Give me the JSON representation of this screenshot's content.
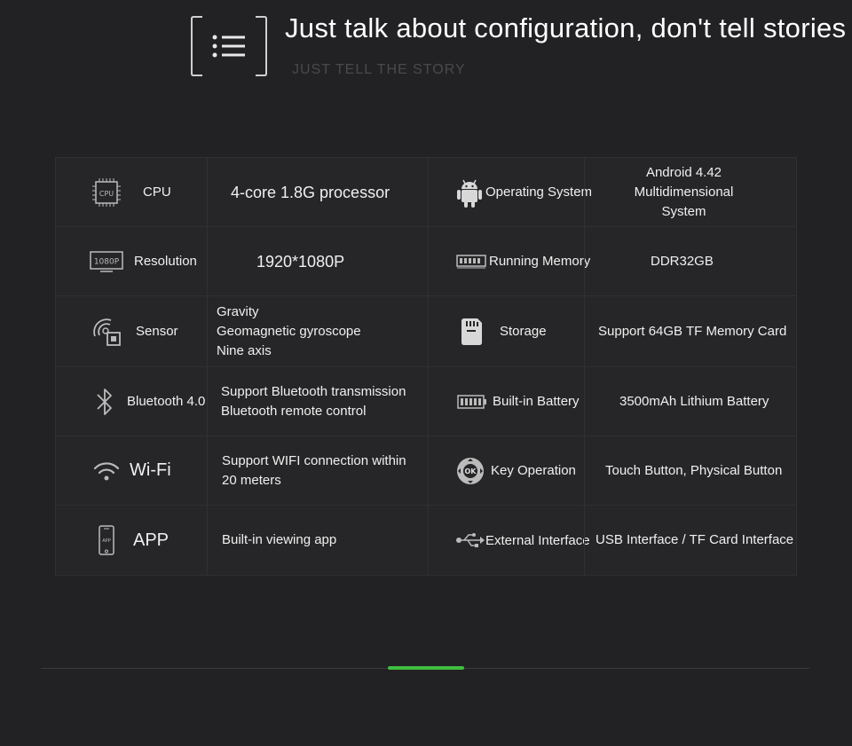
{
  "header": {
    "title": "Just talk about configuration, don't tell stories",
    "subtitle": "JUST TELL THE STORY",
    "icon": "list-menu-icon"
  },
  "specs": [
    {
      "left_label": "CPU",
      "left_icon": "cpu-chip-icon",
      "left_icon_text": "CPU",
      "left_value": "4-core 1.8G processor",
      "right_label": "Operating System",
      "right_icon": "android-icon",
      "right_value": "Android 4.42\nMultidimensional System"
    },
    {
      "left_label": "Resolution",
      "left_icon": "resolution-icon",
      "left_icon_text": "1080P",
      "left_value": "1920*1080P",
      "right_label": "Running Memory",
      "right_icon": "memory-module-icon",
      "right_value": "DDR32GB"
    },
    {
      "left_label": "Sensor",
      "left_icon": "sensor-icon",
      "left_value": "Gravity\nGeomagnetic gyroscope\nNine axis",
      "right_label": "Storage",
      "right_icon": "sd-card-icon",
      "right_value": "Support 64GB TF Memory Card"
    },
    {
      "left_label": "Bluetooth 4.0",
      "left_icon": "bluetooth-icon",
      "left_value": "Support Bluetooth transmission\nBluetooth remote control",
      "right_label": "Built-in Battery",
      "right_icon": "battery-icon",
      "right_value": "3500mAh Lithium Battery"
    },
    {
      "left_label": "Wi-Fi",
      "left_icon": "wifi-icon",
      "left_value": "Support WIFI connection within\n20 meters",
      "right_label": "Key Operation",
      "right_icon": "ok-button-icon",
      "right_icon_text": "OK",
      "right_value": "Touch Button, Physical Button"
    },
    {
      "left_label": "APP",
      "left_icon": "phone-app-icon",
      "left_icon_text": "APP",
      "left_value": "Built-in viewing app",
      "right_label": "External Interface",
      "right_icon": "usb-icon",
      "right_value": "USB Interface / TF Card Interface"
    }
  ],
  "colors": {
    "background": "#222224",
    "accent": "#3fbf3f",
    "grid": "#303032"
  }
}
